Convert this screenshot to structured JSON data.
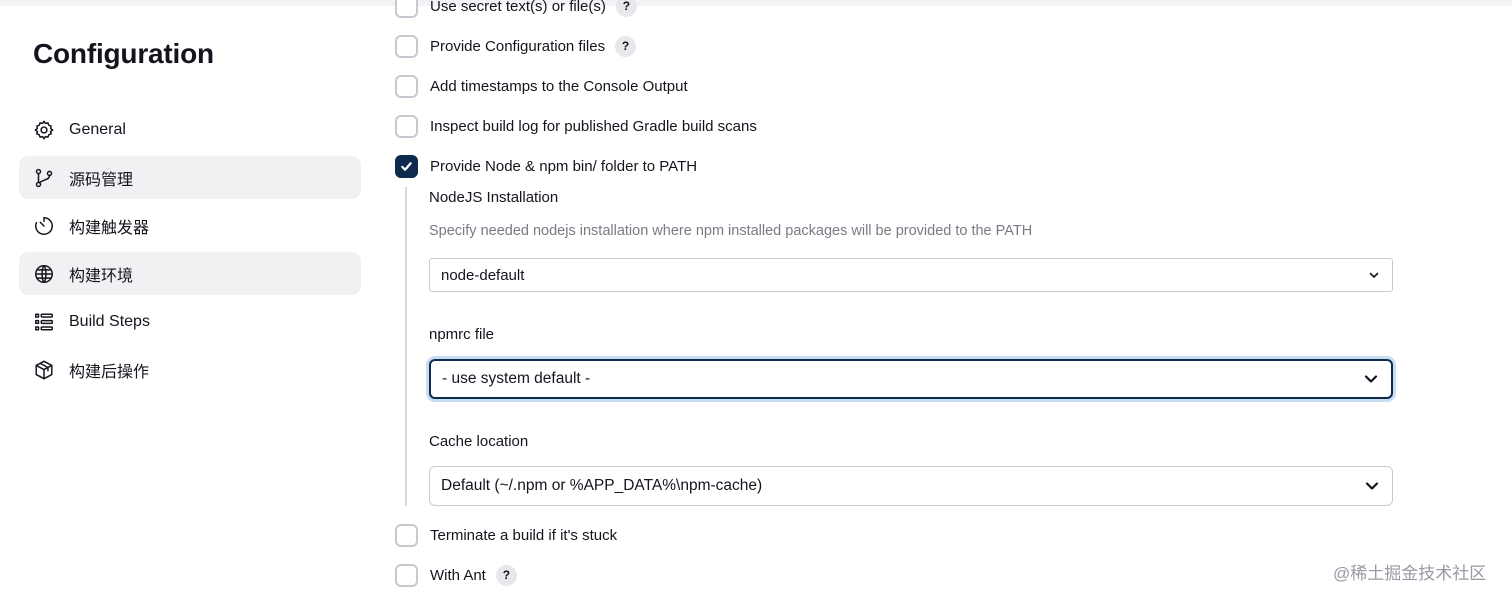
{
  "page": {
    "title": "Configuration"
  },
  "sidebar": {
    "items": [
      {
        "label": "General",
        "icon": "gear-icon",
        "active": false
      },
      {
        "label": "源码管理",
        "icon": "source-branch-icon",
        "active": true
      },
      {
        "label": "构建触发器",
        "icon": "timer-icon",
        "active": false
      },
      {
        "label": "构建环境",
        "icon": "globe-icon",
        "active": true
      },
      {
        "label": "Build Steps",
        "icon": "list-steps-icon",
        "active": false
      },
      {
        "label": "构建后操作",
        "icon": "package-icon",
        "active": false
      }
    ]
  },
  "options": {
    "secret_text": {
      "label": "Use secret text(s) or file(s)",
      "checked": false,
      "help": "?"
    },
    "config_files": {
      "label": "Provide Configuration files",
      "checked": false,
      "help": "?"
    },
    "timestamps": {
      "label": "Add timestamps to the Console Output",
      "checked": false
    },
    "gradle_scans": {
      "label": "Inspect build log for published Gradle build scans",
      "checked": false
    },
    "node_npm": {
      "label": "Provide Node & npm bin/ folder to PATH",
      "checked": true
    },
    "terminate_stuck": {
      "label": "Terminate a build if it's stuck",
      "checked": false
    },
    "with_ant": {
      "label": "With Ant",
      "checked": false,
      "help": "?"
    }
  },
  "node_settings": {
    "installation_label": "NodeJS Installation",
    "installation_description": "Specify needed nodejs installation where npm installed packages will be provided to the PATH",
    "installation_value": "node-default",
    "npmrc_label": "npmrc file",
    "npmrc_value": "- use system default -",
    "cache_label": "Cache location",
    "cache_value": "Default (~/.npm or %APP_DATA%\\npm-cache)"
  },
  "watermark": "@稀土掘金技术社区",
  "colors": {
    "accent": "#0e2b4f",
    "focus_ring": "#c8dcf2",
    "active_nav_bg": "#f1f1f4"
  }
}
